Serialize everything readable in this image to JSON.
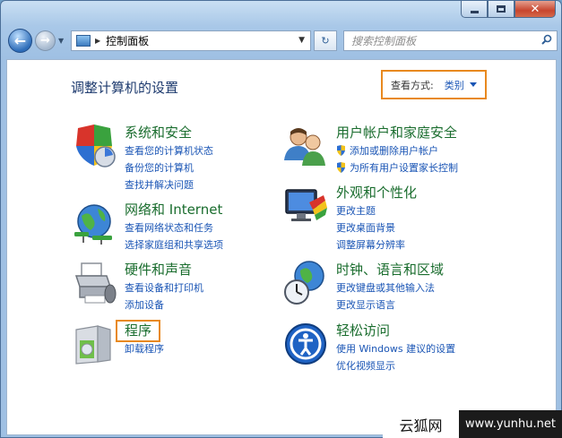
{
  "window": {
    "close_glyph": "✕"
  },
  "nav": {
    "back_glyph": "←",
    "forward_glyph": "→",
    "history_glyph": "▼"
  },
  "address": {
    "separator": "▶",
    "path": "控制面板",
    "dropdown_glyph": "▼",
    "refresh_glyph": "↻"
  },
  "search": {
    "placeholder": "搜索控制面板"
  },
  "main": {
    "title": "调整计算机的设置",
    "view": {
      "label": "查看方式:",
      "value": "类别"
    }
  },
  "categories": [
    {
      "title": "系统和安全",
      "icon": "shield-flag-icon",
      "links": [
        "查看您的计算机状态",
        "备份您的计算机",
        "查找并解决问题"
      ]
    },
    {
      "title": "网络和 Internet",
      "icon": "network-globe-icon",
      "links": [
        "查看网络状态和任务",
        "选择家庭组和共享选项"
      ]
    },
    {
      "title": "硬件和声音",
      "icon": "printer-icon",
      "links": [
        "查看设备和打印机",
        "添加设备"
      ]
    },
    {
      "title": "程序",
      "icon": "programs-box-icon",
      "links": [
        "卸载程序"
      ]
    },
    {
      "title": "用户帐户和家庭安全",
      "icon": "users-icon",
      "links": [
        "添加或删除用户帐户",
        "为所有用户设置家长控制"
      ]
    },
    {
      "title": "外观和个性化",
      "icon": "monitor-palette-icon",
      "links": [
        "更改主题",
        "更改桌面背景",
        "调整屏幕分辨率"
      ]
    },
    {
      "title": "时钟、语言和区域",
      "icon": "clock-globe-icon",
      "links": [
        "更改键盘或其他输入法",
        "更改显示语言"
      ]
    },
    {
      "title": "轻松访问",
      "icon": "ease-of-access-icon",
      "links": [
        "使用 Windows 建议的设置",
        "优化视频显示"
      ]
    }
  ],
  "watermark": {
    "left": "云狐网",
    "right": "www.yunhu.net"
  },
  "colors": {
    "link": "#1a55b5",
    "category_title": "#1a6d2e",
    "highlight": "#e8891f"
  }
}
